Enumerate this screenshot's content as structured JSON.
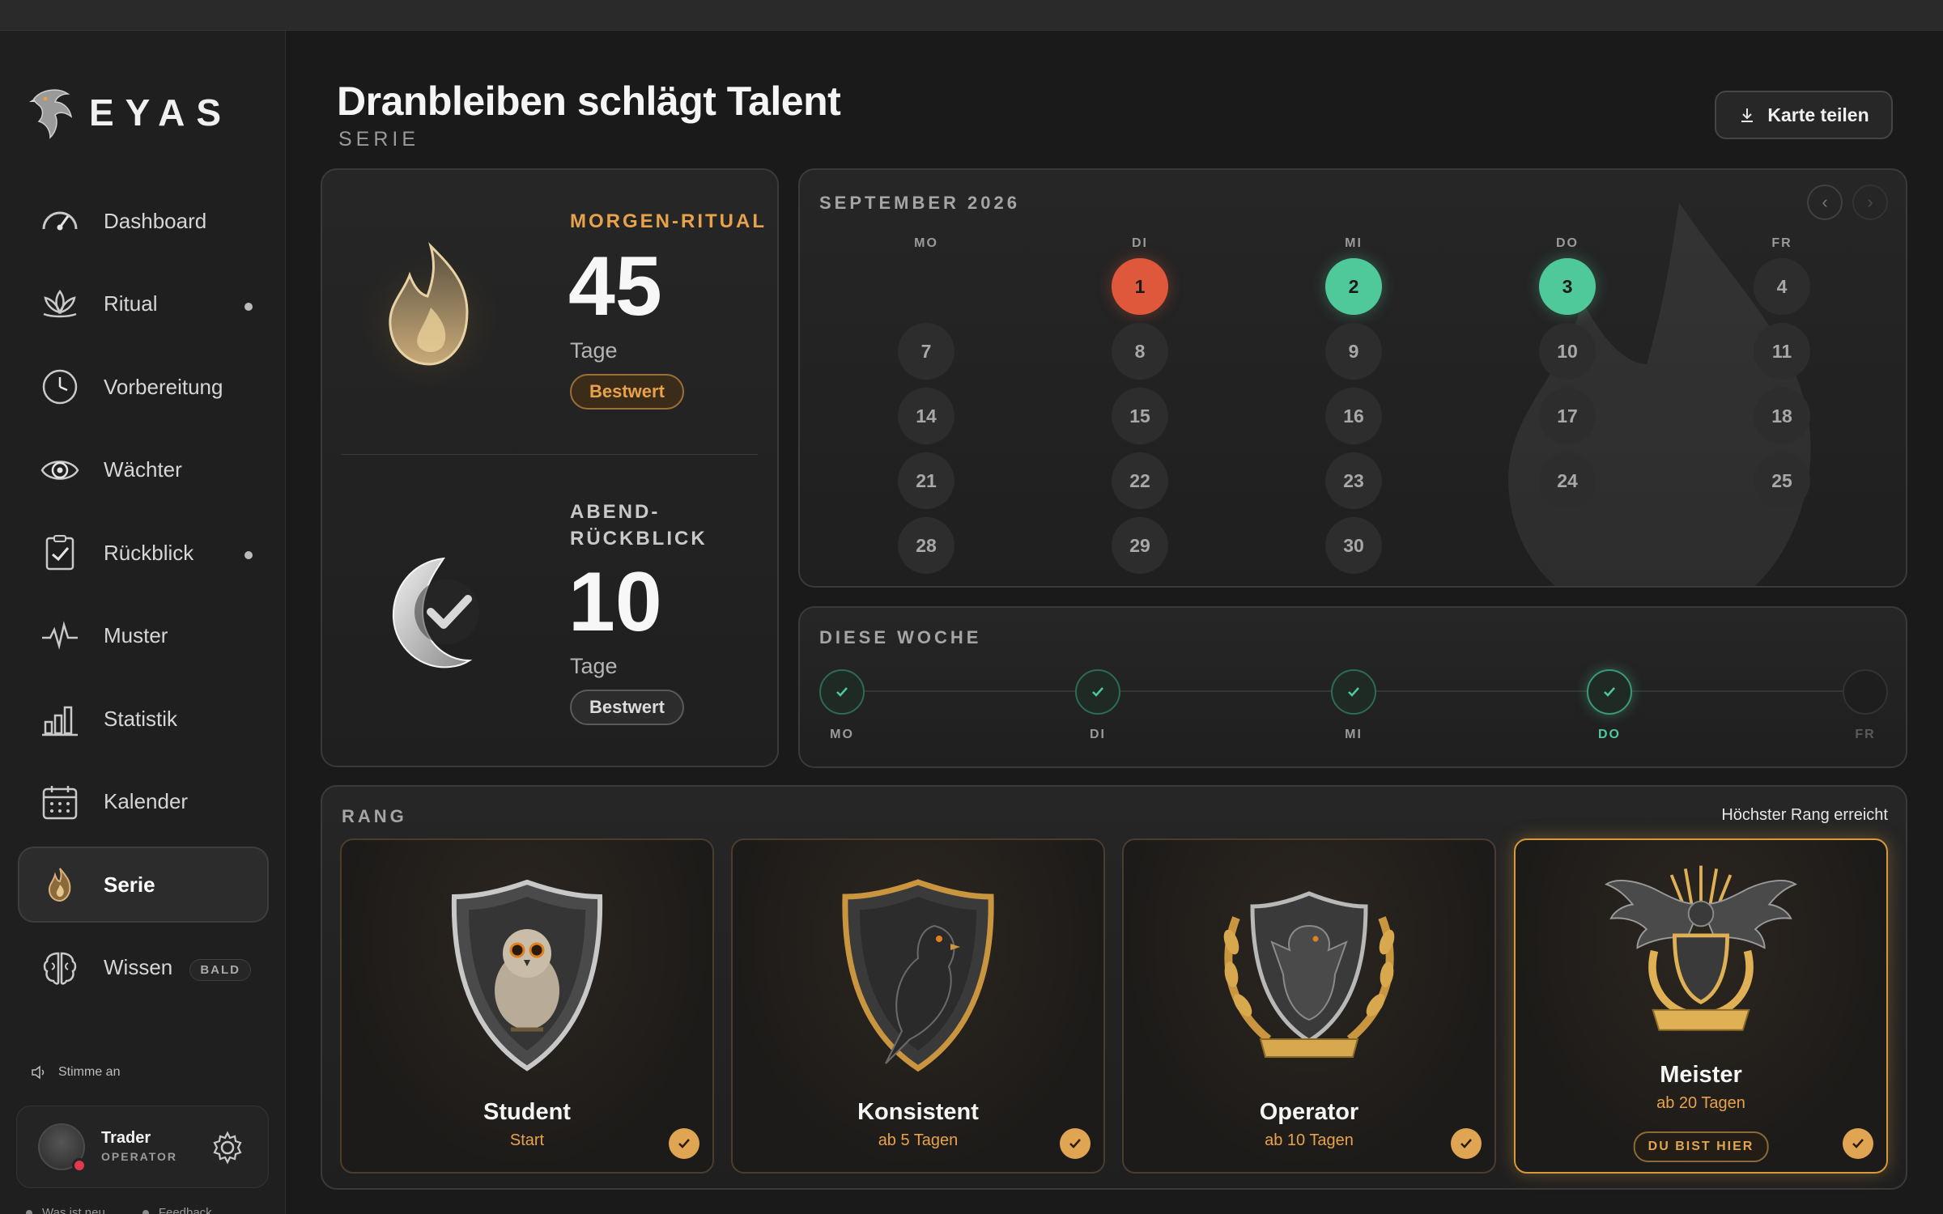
{
  "brand": {
    "name": "EYAS"
  },
  "sidebar": {
    "items": [
      {
        "label": "Dashboard",
        "icon": "gauge-icon"
      },
      {
        "label": "Ritual",
        "icon": "lotus-icon"
      },
      {
        "label": "Vorbereitung",
        "icon": "clock-icon"
      },
      {
        "label": "Wächter",
        "icon": "eye-icon"
      },
      {
        "label": "Rückblick",
        "icon": "clipboard-check-icon"
      },
      {
        "label": "Muster",
        "icon": "pulse-icon"
      },
      {
        "label": "Statistik",
        "icon": "bar-chart-icon"
      },
      {
        "label": "Kalender",
        "icon": "calendar-icon"
      },
      {
        "label": "Serie",
        "icon": "flame-icon"
      },
      {
        "label": "Wissen",
        "icon": "brain-icon",
        "badge": "BALD"
      }
    ],
    "voice_label": "Stimme an",
    "user": {
      "name": "Trader",
      "role": "OPERATOR"
    },
    "footer": {
      "whats_new": "Was ist neu",
      "feedback": "Feedback"
    }
  },
  "header": {
    "title": "Dranbleiben schlägt Talent",
    "subtitle": "SERIE",
    "share_label": "Karte teilen"
  },
  "streaks": {
    "morning": {
      "kicker": "MORGEN-RITUAL",
      "value": "45",
      "unit": "Tage",
      "badge": "Bestwert"
    },
    "evening": {
      "kicker_line1": "ABEND-",
      "kicker_line2": "RÜCKBLICK",
      "value": "10",
      "unit": "Tage",
      "badge": "Bestwert"
    }
  },
  "calendar": {
    "title": "SEPTEMBER 2026",
    "weekdays": [
      "MO",
      "DI",
      "MI",
      "DO",
      "FR"
    ],
    "rows": [
      [
        "",
        "1",
        "2",
        "3",
        "4"
      ],
      [
        "7",
        "8",
        "9",
        "10",
        "11"
      ],
      [
        "14",
        "15",
        "16",
        "17",
        "18"
      ],
      [
        "21",
        "22",
        "23",
        "24",
        "25"
      ],
      [
        "28",
        "29",
        "30",
        "",
        ""
      ]
    ],
    "status_colors": {
      "missed": "#e0583c",
      "done": "#4fc89a"
    }
  },
  "week": {
    "title": "DIESE WOCHE",
    "days": [
      "MO",
      "DI",
      "MI",
      "DO",
      "FR"
    ]
  },
  "rank": {
    "title": "RANG",
    "note": "Höchster Rang erreicht",
    "levels": [
      {
        "name": "Student",
        "req": "Start"
      },
      {
        "name": "Konsistent",
        "req": "ab 5 Tagen"
      },
      {
        "name": "Operator",
        "req": "ab 10 Tagen"
      },
      {
        "name": "Meister",
        "req": "ab 20 Tagen",
        "here": "DU BIST HIER"
      }
    ]
  },
  "colors": {
    "accent_gold": "#e8a24a",
    "accent_green": "#4fc89a",
    "accent_red": "#e0583c"
  }
}
